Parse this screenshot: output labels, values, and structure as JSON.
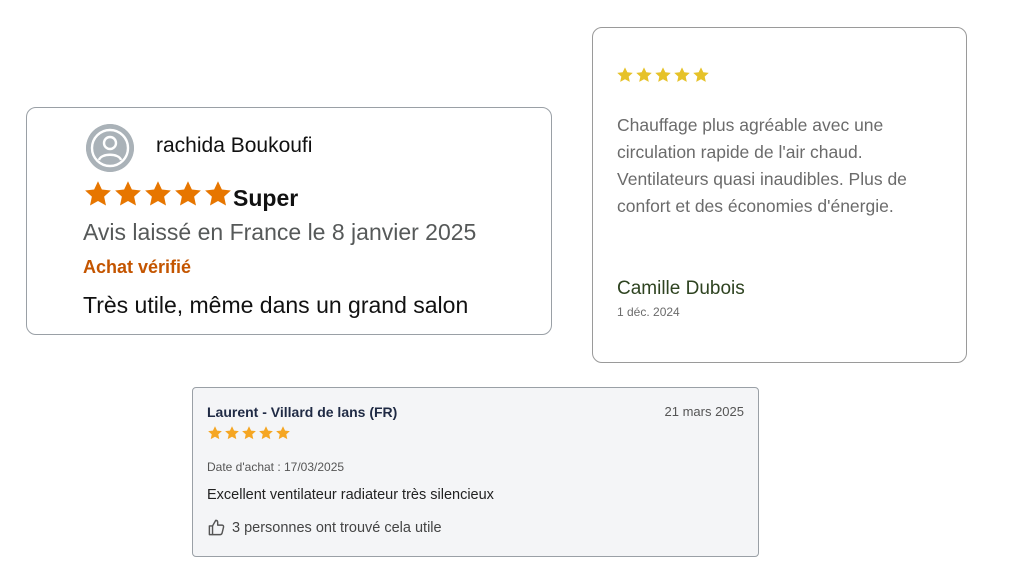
{
  "reviews": {
    "amazon": {
      "author": "rachida Boukoufi",
      "rating": 5,
      "title": "Super",
      "date": "Avis laissé en France le 8 janvier 2025",
      "verified": "Achat vérifié",
      "body": "Très utile, même dans un grand salon",
      "icons": {
        "avatar": "user-avatar-icon",
        "star": "star-icon"
      },
      "colors": {
        "star": "#e77600",
        "verified": "#c45500"
      }
    },
    "testimonial": {
      "rating": 5,
      "body": "Chauffage plus agréable avec une circulation rapide de l'air chaud. Ventilateurs quasi inaudibles. Plus de confort et des économies d'énergie.",
      "author": "Camille Dubois",
      "date": "1 déc. 2024",
      "icons": {
        "star": "star-icon"
      },
      "colors": {
        "star": "#e6c229",
        "author": "#2e4320"
      }
    },
    "store": {
      "author": "Laurent - Villard de lans (FR)",
      "date": "21 mars 2025",
      "rating": 5,
      "purchase_date": "Date d'achat : 17/03/2025",
      "body": "Excellent ventilateur radiateur très silencieux",
      "helpful": "3 personnes ont trouvé cela utile",
      "icons": {
        "star": "star-icon",
        "helpful": "thumbs-up-icon"
      },
      "colors": {
        "star": "#f5a623"
      }
    }
  }
}
